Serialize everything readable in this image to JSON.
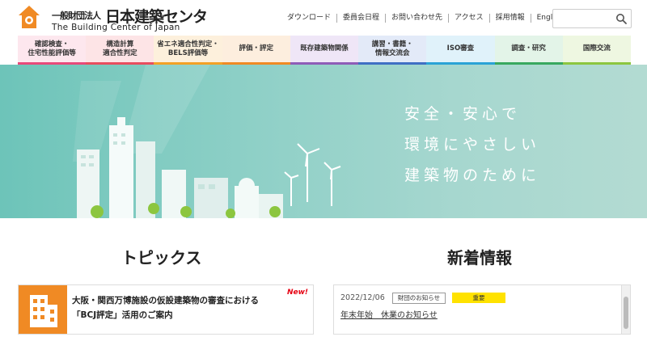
{
  "header": {
    "org_prefix": "一般財団法人",
    "org_name": "日本建築センター",
    "org_name_en": "The Building Center of Japan"
  },
  "utility_nav": [
    "ダウンロード",
    "委員会日程",
    "お問い合わせ先",
    "アクセス",
    "採用情報",
    "English"
  ],
  "search": {
    "placeholder": ""
  },
  "main_nav": [
    {
      "line1": "確認検査・",
      "line2": "住宅性能評価等",
      "color": "#e8497a",
      "bg": "#fde7ee"
    },
    {
      "line1": "構造計算",
      "line2": "適合性判定",
      "color": "#e84d5e",
      "bg": "#fde4e6"
    },
    {
      "line1": "省エネ適合性判定・",
      "line2": "BELS評価等",
      "color": "#f3a126",
      "bg": "#fdf0dc"
    },
    {
      "line1": "評価・評定",
      "line2": "",
      "color": "#f08a24",
      "bg": "#fdeede"
    },
    {
      "line1": "既存建築物関係",
      "line2": "",
      "color": "#8e5cb8",
      "bg": "#efe6f7"
    },
    {
      "line1": "講習・書籍・",
      "line2": "情報交流会",
      "color": "#3f6fc4",
      "bg": "#e3eaf8"
    },
    {
      "line1": "ISO審査",
      "line2": "",
      "color": "#2aa3d6",
      "bg": "#e0f2fa"
    },
    {
      "line1": "調査・研究",
      "line2": "",
      "color": "#38a85f",
      "bg": "#e3f4e8"
    },
    {
      "line1": "国際交流",
      "line2": "",
      "color": "#8cc63f",
      "bg": "#eef7e1"
    }
  ],
  "hero": {
    "line1": "安全・安心で",
    "line2": "環境にやさしい",
    "line3": "建築物のために"
  },
  "topics": {
    "title": "トピックス",
    "card": {
      "line1": "大阪・関西万博施設の仮設建築物の審査における",
      "line2": "「BCJ評定」活用のご案内",
      "badge": "New!"
    }
  },
  "news": {
    "title": "新着情報",
    "item": {
      "date": "2022/12/06",
      "category": "財団のお知らせ",
      "importance": "重要",
      "text": "年末年始　休業のお知らせ"
    }
  }
}
